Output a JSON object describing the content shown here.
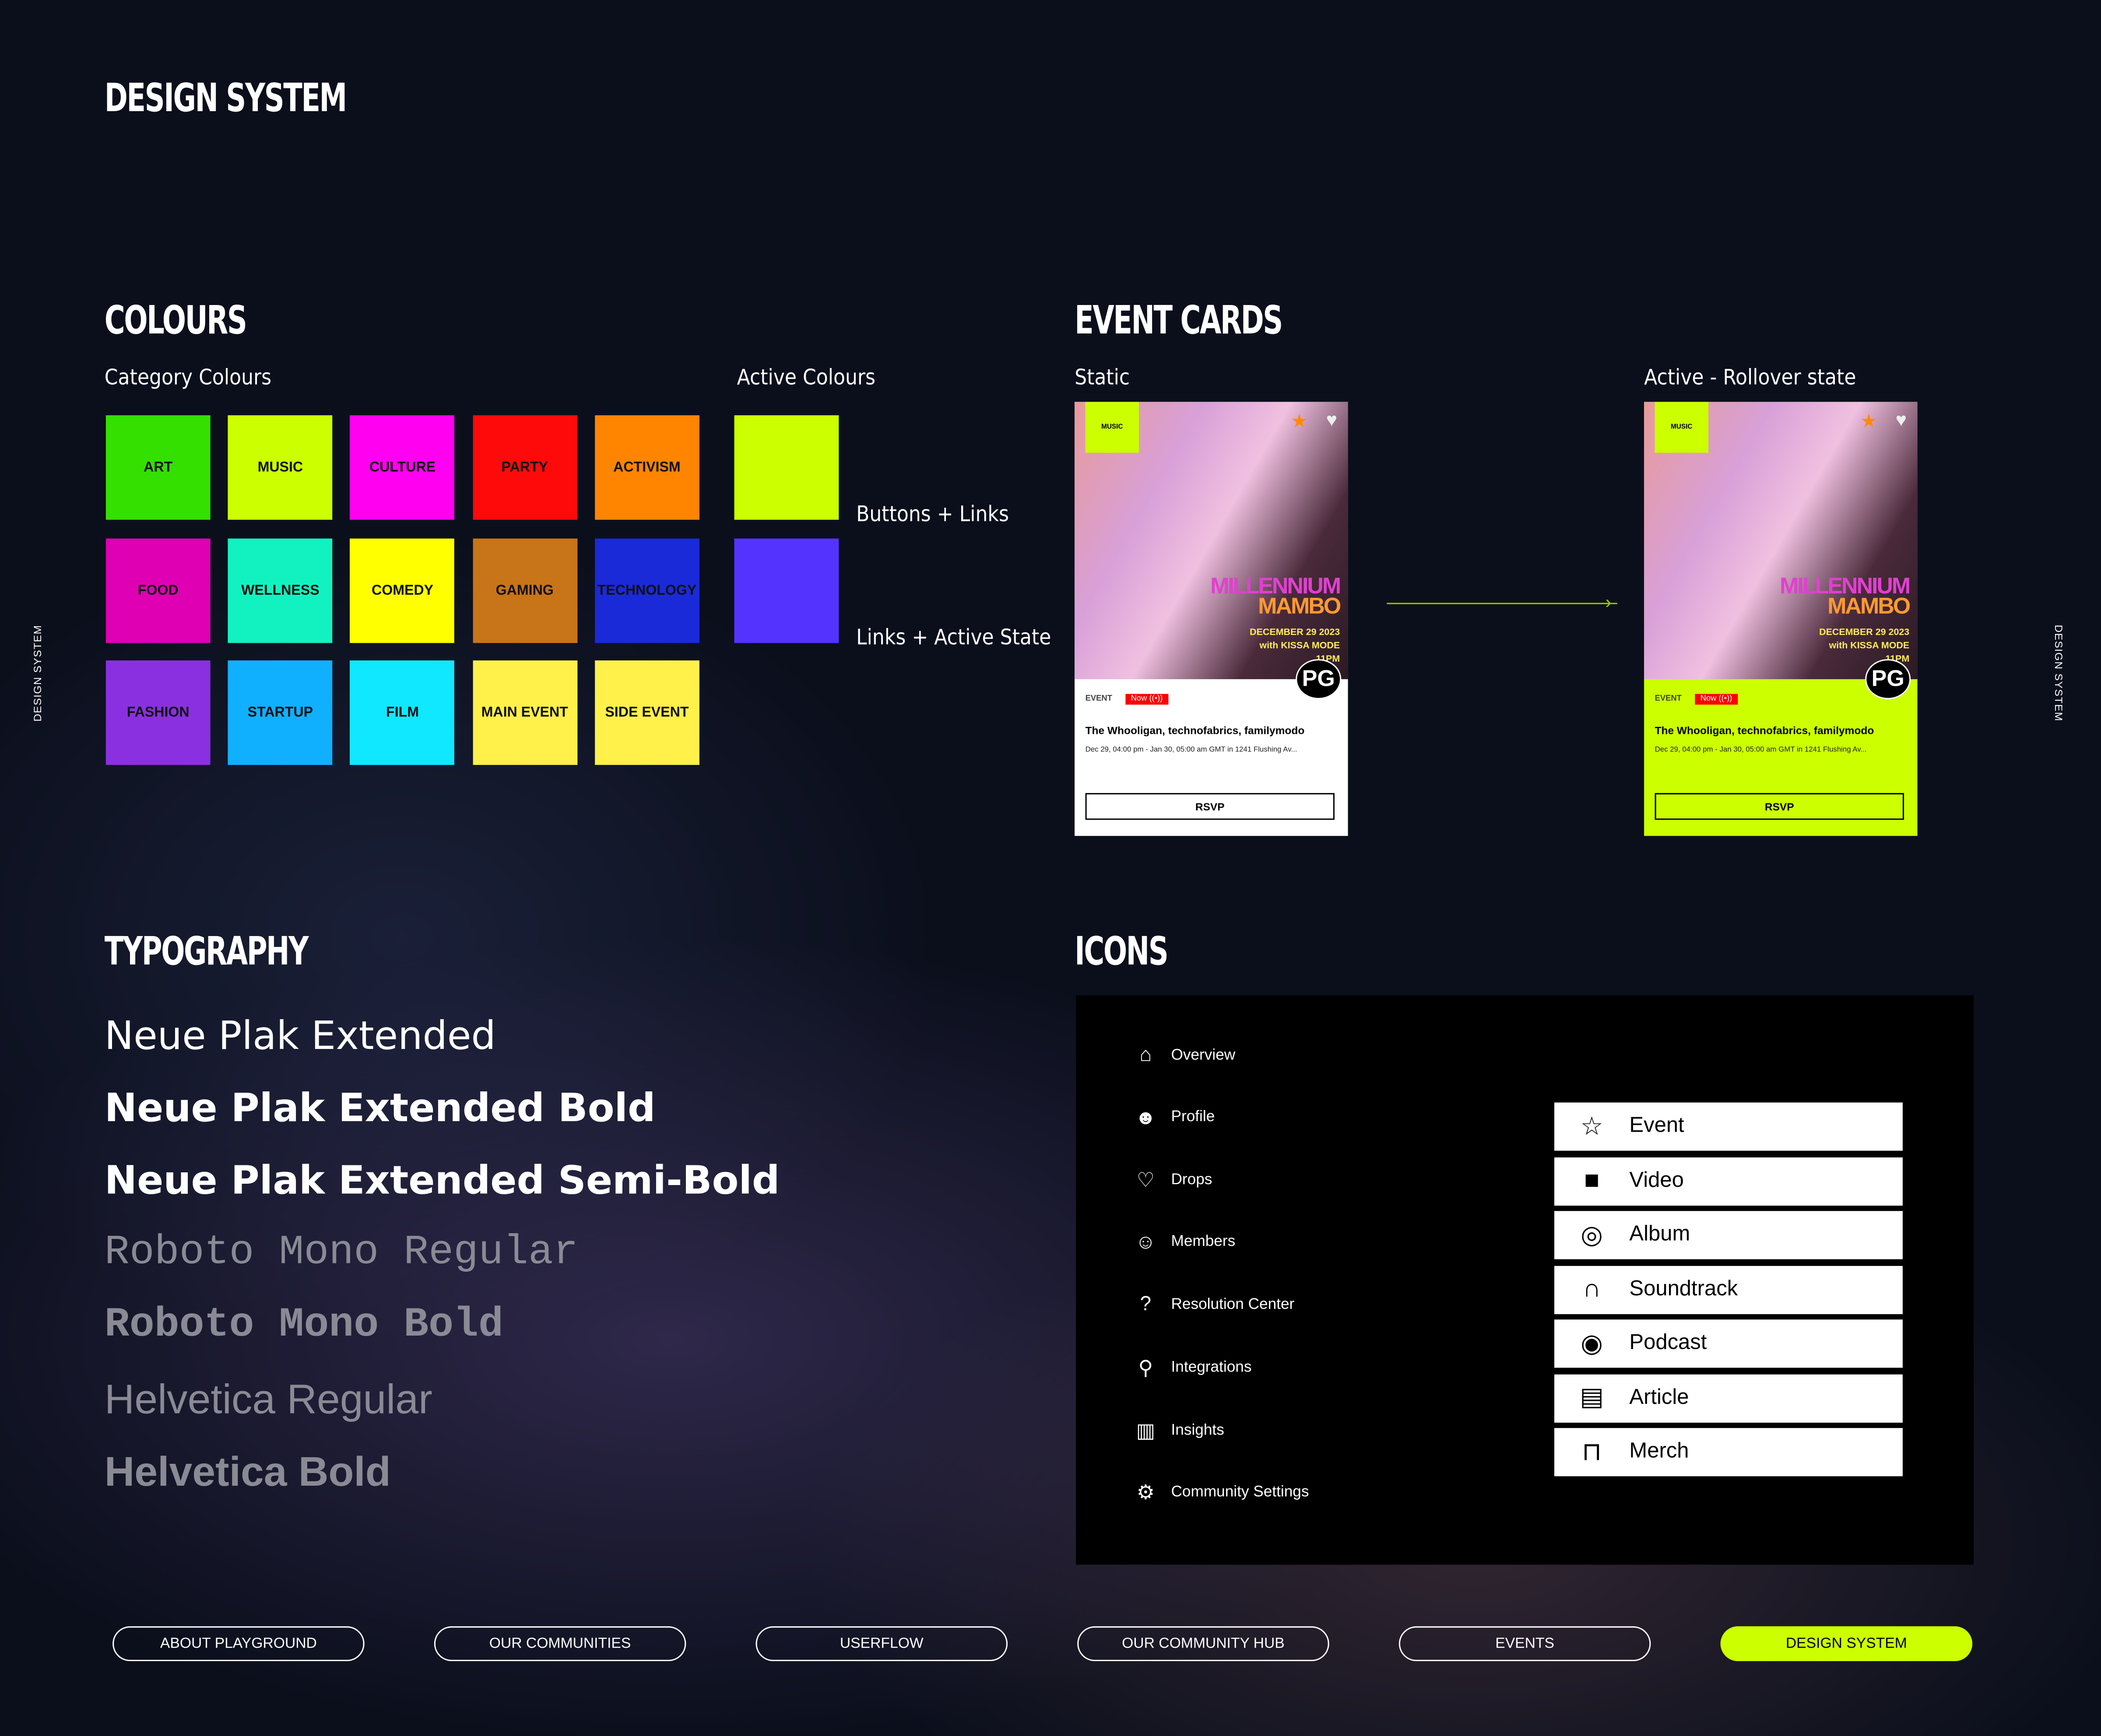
{
  "page_title": "DESIGN SYSTEM",
  "side_label": "DESIGN SYSTEM",
  "colours": {
    "heading": "COLOURS",
    "category_label": "Category Colours",
    "active_label": "Active Colours",
    "categories": [
      {
        "label": "ART",
        "color": "#33e000"
      },
      {
        "label": "MUSIC",
        "color": "#ccff00"
      },
      {
        "label": "CULTURE",
        "color": "#ff00f0"
      },
      {
        "label": "PARTY",
        "color": "#ff0a0a"
      },
      {
        "label": "ACTIVISM",
        "color": "#ff8400"
      },
      {
        "label": "FOOD",
        "color": "#e000b4"
      },
      {
        "label": "WELLNESS",
        "color": "#12f2c0"
      },
      {
        "label": "COMEDY",
        "color": "#ffff00"
      },
      {
        "label": "GAMING",
        "color": "#c87418"
      },
      {
        "label": "TECHNOLOGY",
        "color": "#1a2ad8"
      },
      {
        "label": "FASHION",
        "color": "#8a30e0"
      },
      {
        "label": "STARTUP",
        "color": "#10b0ff"
      },
      {
        "label": "FILM",
        "color": "#10e8ff"
      },
      {
        "label": "MAIN EVENT",
        "color": "#fff04a"
      },
      {
        "label": "SIDE EVENT",
        "color": "#fff04a"
      }
    ],
    "active": [
      {
        "label": "Buttons + Links",
        "color": "#ccff00"
      },
      {
        "label": "Links + Active State",
        "color": "#5533ff"
      }
    ]
  },
  "event_cards": {
    "heading": "EVENT CARDS",
    "static_label": "Static",
    "active_label": "Active - Rollover state",
    "card": {
      "category": "MUSIC",
      "poster_title": "MILLENNIUM",
      "poster_title2": "MAMBO",
      "poster_date": "DECEMBER 29 2023",
      "poster_with": "with KISSA MODE",
      "poster_time": "11PM",
      "rating": "PG",
      "type": "EVENT",
      "status": "Now ((•))",
      "title": "The Whooligan, technofabrics, familymodo",
      "details": "Dec 29, 04:00 pm - Jan 30, 05:00 am GMT in 1241 Flushing Av...",
      "rsvp": "RSVP"
    },
    "active_bg": "#ccff00"
  },
  "typography": {
    "heading": "TYPOGRAPHY",
    "samples": [
      "Neue Plak Extended",
      "Neue Plak Extended Bold",
      "Neue Plak Extended Semi-Bold",
      "Roboto Mono Regular",
      "Roboto Mono Bold",
      "Helvetica Regular",
      "Helvetica Bold"
    ]
  },
  "icons": {
    "heading": "ICONS",
    "nav": [
      {
        "label": "Overview",
        "icon": "home-star-icon"
      },
      {
        "label": "Profile",
        "icon": "profile-icon"
      },
      {
        "label": "Drops",
        "icon": "cards-icon"
      },
      {
        "label": "Members",
        "icon": "members-icon"
      },
      {
        "label": "Resolution Center",
        "icon": "question-icon"
      },
      {
        "label": "Integrations",
        "icon": "plug-icon"
      },
      {
        "label": "Insights",
        "icon": "bar-chart-icon"
      },
      {
        "label": "Community Settings",
        "icon": "gear-icon"
      }
    ],
    "content": [
      {
        "label": "Event",
        "icon": "ticket-icon"
      },
      {
        "label": "Video",
        "icon": "video-camera-icon"
      },
      {
        "label": "Album",
        "icon": "vinyl-icon"
      },
      {
        "label": "Soundtrack",
        "icon": "headphones-icon"
      },
      {
        "label": "Podcast",
        "icon": "podcast-icon"
      },
      {
        "label": "Article",
        "icon": "article-icon"
      },
      {
        "label": "Merch",
        "icon": "bag-icon"
      }
    ]
  },
  "footer_nav": [
    {
      "label": "ABOUT PLAYGROUND"
    },
    {
      "label": "OUR COMMUNITIES"
    },
    {
      "label": "USERFLOW"
    },
    {
      "label": "OUR COMMUNITY HUB"
    },
    {
      "label": "EVENTS"
    },
    {
      "label": "DESIGN SYSTEM",
      "active": true
    }
  ]
}
